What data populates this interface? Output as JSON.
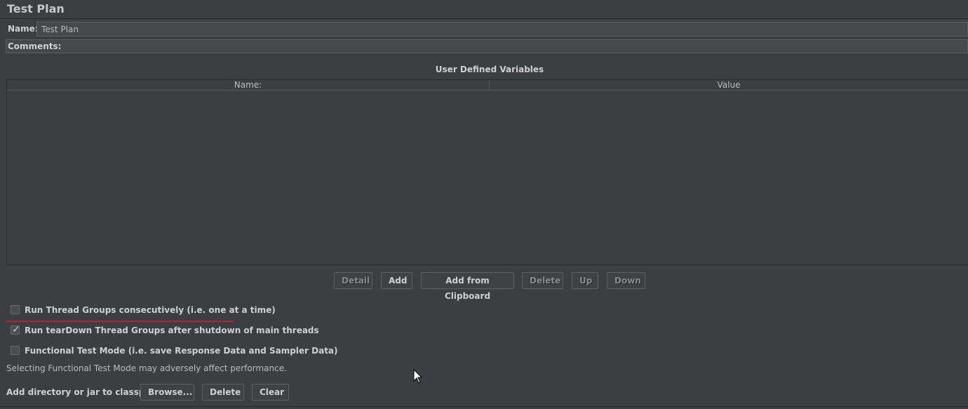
{
  "page": {
    "title": "Test Plan"
  },
  "form": {
    "name_label": "Name:",
    "name_value": "Test Plan",
    "comments_label": "Comments:"
  },
  "variables": {
    "title": "User Defined Variables",
    "columns": [
      "Name:",
      "Value"
    ],
    "rows": []
  },
  "table_buttons": {
    "detail": "Detail",
    "add": "Add",
    "add_clipboard": "Add from Clipboard",
    "delete": "Delete",
    "up": "Up",
    "down": "Down"
  },
  "options": [
    {
      "label": "Run Thread Groups consecutively (i.e. one at a time)",
      "checked": false
    },
    {
      "label": "Run tearDown Thread Groups after shutdown of main threads",
      "checked": true
    },
    {
      "label": "Functional Test Mode (i.e. save Response Data and Sampler Data)",
      "checked": false
    }
  ],
  "functional_note": "Selecting Functional Test Mode may adversely affect performance.",
  "classpath": {
    "label": "Add directory or jar to classpath",
    "browse": "Browse...",
    "delete": "Delete",
    "clear": "Clear"
  },
  "colors": {
    "background": "#3c3f41",
    "highlight_underline": "#b3262e"
  },
  "icons": [
    "checkbox-icon",
    "checkmark-icon",
    "mouse-cursor-icon"
  ]
}
